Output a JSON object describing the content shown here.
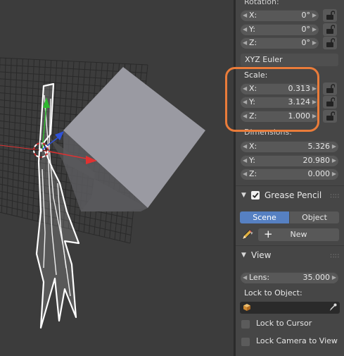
{
  "colors": {
    "viewport_bg": "#3c3c3c",
    "panel_bg": "#464646",
    "field_bg": "#585858",
    "selected_tab": "#5680c2",
    "highlight": "#ea7c3a",
    "x_axis": "#e03131",
    "y_axis": "#2eb82e",
    "z_axis": "#2f52d8"
  },
  "rotation": {
    "label": "Rotation:",
    "x": {
      "label": "X:",
      "value": "0°"
    },
    "y": {
      "label": "Y:",
      "value": "0°"
    },
    "z": {
      "label": "Z:",
      "value": "0°"
    },
    "mode": "XYZ Euler"
  },
  "scale": {
    "label": "Scale:",
    "x": {
      "label": "X:",
      "value": "0.313"
    },
    "y": {
      "label": "Y:",
      "value": "3.124"
    },
    "z": {
      "label": "Z:",
      "value": "1.000"
    }
  },
  "dimensions": {
    "label": "Dimensions:",
    "x": {
      "label": "X:",
      "value": "5.326"
    },
    "y": {
      "label": "Y:",
      "value": "20.980"
    },
    "z": {
      "label": "Z:",
      "value": "0.000"
    }
  },
  "grease_pencil": {
    "title": "Grease Pencil",
    "enabled": true,
    "tabs": [
      "Scene",
      "Object"
    ],
    "active_tab": "Scene",
    "new_label": "New"
  },
  "view": {
    "title": "View",
    "lens": {
      "label": "Lens:",
      "value": "35.000"
    },
    "lock_to_object_label": "Lock to Object:",
    "lock_to_cursor_label": "Lock to Cursor",
    "lock_camera_label": "Lock Camera to View"
  },
  "icons": [
    "lock-icon",
    "triangle-down-icon",
    "pencil-icon",
    "plus-icon",
    "cube-icon",
    "eyedropper-icon",
    "grip-icon"
  ]
}
